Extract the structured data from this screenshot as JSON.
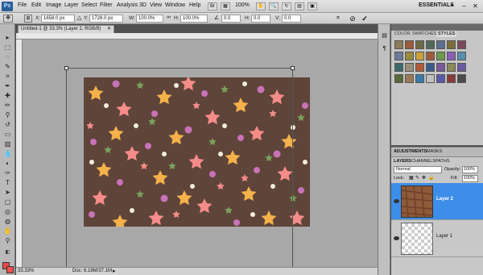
{
  "app": {
    "logo": "Ps",
    "menu": [
      "File",
      "Edit",
      "Image",
      "Layer",
      "Select",
      "Filter",
      "Analysis",
      "3D",
      "View",
      "Window",
      "Help"
    ],
    "zoom_button": "100%",
    "workspace": "ESSENTIALS"
  },
  "options_bar": {
    "x_label": "X:",
    "x_value": "1658.0 px",
    "y_label": "Y:",
    "y_value": "1728.0 px",
    "w_label": "W:",
    "w_value": "100.0%",
    "h_label": "H:",
    "h_value": "100.0%",
    "angle_value": "0.0",
    "hskew_label": "H:",
    "hskew_value": "0.0",
    "vskew_label": "V:",
    "vskew_value": "0.0",
    "cancel_icon": "cancel-icon",
    "commit_icon": "commit-checkmark-icon"
  },
  "document": {
    "tab_title": "Untitled-1 @ 33.3% (Layer 2, RGB/8)",
    "zoom": "33.33%",
    "doc_size": "Doc: 6.18M/37.1M"
  },
  "tools": {
    "foreground_color": "#ef4a49",
    "background_color": "#ff4d4d"
  },
  "styles_panel": {
    "tabs": [
      "COLOR",
      "SWATCHES",
      "STYLES"
    ],
    "active_tab": "STYLES",
    "swatches": [
      "#8a7d5a",
      "#9b5b3a",
      "#6e6a48",
      "#4f6a5a",
      "#5b7090",
      "#7b6d3a",
      "#7c4a5c",
      "#6d7a9a",
      "#9a8b3c",
      "#c9a23f",
      "#a05a3a",
      "#6a9a4a",
      "#8a5fb5",
      "#5a8fb0",
      "#3a6a6a",
      "#9a8f7a",
      "#b05a3a",
      "#3a5a8a",
      "#7a5a9a",
      "#8a8a5a",
      "#6a5aa0",
      "#5a6a3a",
      "#9a7a5a",
      "#3a7aaa",
      "#c0c0c0",
      "#5a5aaa",
      "#8a3a3a",
      "#4a4a4a"
    ]
  },
  "adjustments_panel": {
    "tabs": [
      "ADJUSTMENTS",
      "MASKS"
    ]
  },
  "layers_panel": {
    "tabs": [
      "LAYERS",
      "CHANNELS",
      "PATHS"
    ],
    "blend_mode": "Normal",
    "opacity_label": "Opacity:",
    "opacity_value": "100%",
    "lock_label": "Lock:",
    "fill_label": "Fill:",
    "fill_value": "100%",
    "layers": [
      {
        "name": "Layer 2",
        "selected": true
      },
      {
        "name": "Layer 1",
        "selected": false
      }
    ]
  }
}
